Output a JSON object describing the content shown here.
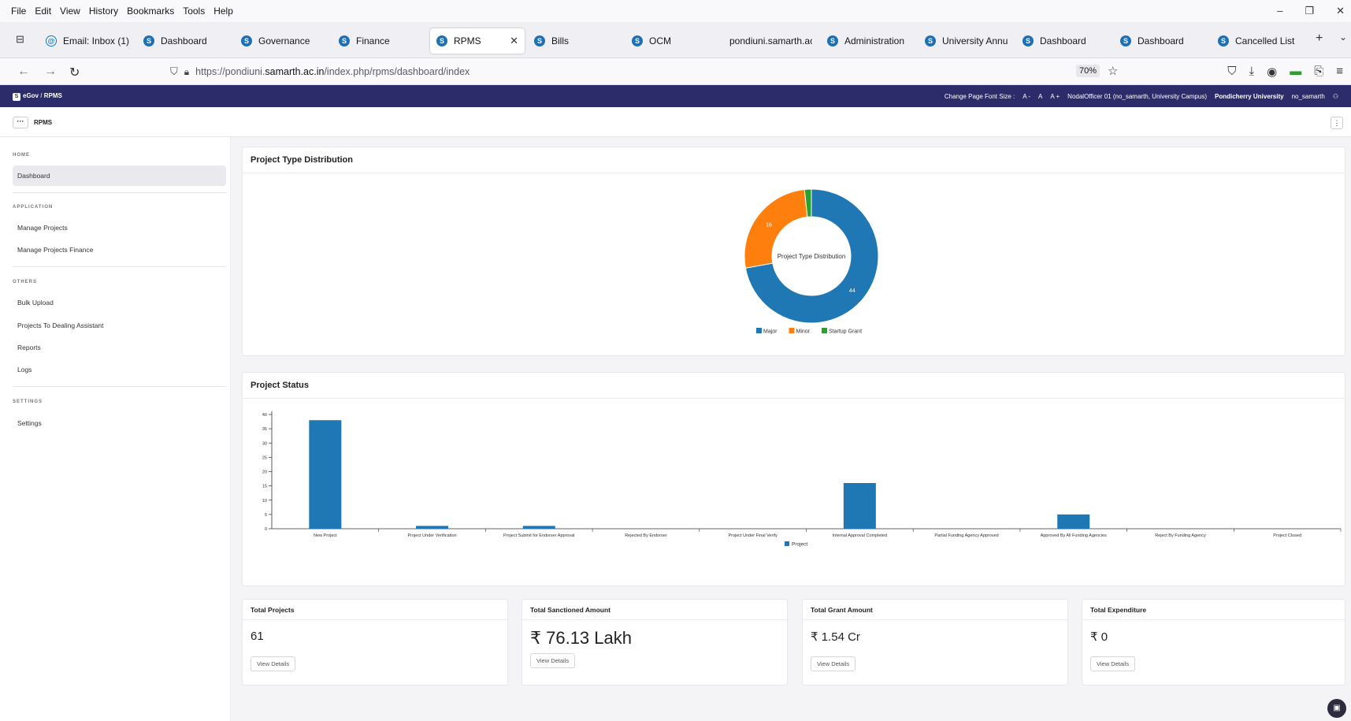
{
  "menubar": [
    "File",
    "Edit",
    "View",
    "History",
    "Bookmarks",
    "Tools",
    "Help"
  ],
  "tabs": [
    {
      "label": "Email: Inbox (1)",
      "icon": "mail-icon"
    },
    {
      "label": "Dashboard",
      "icon": "samarth-icon"
    },
    {
      "label": "Governance",
      "icon": "samarth-icon"
    },
    {
      "label": "Finance",
      "icon": "samarth-icon"
    },
    {
      "label": "RPMS",
      "icon": "samarth-icon",
      "active": true
    },
    {
      "label": "Bills",
      "icon": "samarth-icon"
    },
    {
      "label": "OCM",
      "icon": "samarth-icon"
    },
    {
      "label": "pondiuni.samarth.ac.i",
      "icon": ""
    },
    {
      "label": "Administration",
      "icon": "samarth-icon"
    },
    {
      "label": "University Annual",
      "icon": "samarth-icon"
    },
    {
      "label": "Dashboard",
      "icon": "samarth-icon"
    },
    {
      "label": "Dashboard",
      "icon": "samarth-icon"
    },
    {
      "label": "Cancelled List",
      "icon": "samarth-icon"
    }
  ],
  "url": {
    "prefix": "https://pondiuni.",
    "host": "samarth.ac.in",
    "path": "/index.php/rpms/dashboard/index"
  },
  "zoom": "70%",
  "header": {
    "brand": "eGov",
    "breadcrumb": "RPMS",
    "font_size_label": "Change Page Font Size :",
    "font_sizes": [
      "A -",
      "A",
      "A +"
    ],
    "user": "NodalOfficer 01 (no_samarth, University Campus)",
    "university": "Pondicherry University",
    "username": "no_samarth"
  },
  "module": "RPMS",
  "sidebar": {
    "sections": [
      {
        "title": "HOME",
        "items": [
          "Dashboard"
        ]
      },
      {
        "title": "APPLICATION",
        "items": [
          "Manage Projects",
          "Manage Projects Finance"
        ]
      },
      {
        "title": "OTHERS",
        "items": [
          "Bulk Upload",
          "Projects To Dealing Assistant",
          "Reports",
          "Logs"
        ]
      },
      {
        "title": "SETTINGS",
        "items": [
          "Settings"
        ]
      }
    ]
  },
  "cards": {
    "donut_title": "Project Type Distribution",
    "bar_title": "Project Status"
  },
  "chart_data": [
    {
      "type": "pie",
      "title": "Project Type Distribution",
      "categories": [
        "Major",
        "Minor",
        "Startup Grant"
      ],
      "values": [
        44,
        16,
        1
      ],
      "colors": [
        "#1f77b4",
        "#ff7f0e",
        "#2ca02c"
      ],
      "value_labels": [
        "44",
        "16",
        ""
      ],
      "legend": "bottom"
    },
    {
      "type": "bar",
      "title": "Project Status",
      "categories": [
        "New Project",
        "Project Under Verification",
        "Project Submit for Endorser Approval",
        "Rejected By Endorser",
        "Project Under Final Verify",
        "Internal Approval Completed",
        "Partial Funding Agency Approved",
        "Approved By All Funding Agencies",
        "Reject By Funding Agency",
        "Project Closed"
      ],
      "series": [
        {
          "name": "Project",
          "values": [
            38,
            1,
            1,
            0,
            0,
            16,
            0,
            5,
            0,
            0
          ],
          "color": "#1f77b4"
        }
      ],
      "yticks": [
        "0",
        "5",
        "10",
        "15",
        "20",
        "25",
        "30",
        "35",
        "40"
      ],
      "ylim": [
        0,
        40
      ],
      "legend": "bottom"
    }
  ],
  "stats": [
    {
      "title": "Total Projects",
      "value": "61",
      "button": "View Details"
    },
    {
      "title": "Total Sanctioned Amount",
      "value": "₹ 76.13 Lakh",
      "button": "View Details"
    },
    {
      "title": "Total Grant Amount",
      "value": "₹ 1.54 Cr",
      "button": "View Details"
    },
    {
      "title": "Total Expenditure",
      "value": "₹ 0",
      "button": "View Details"
    }
  ]
}
